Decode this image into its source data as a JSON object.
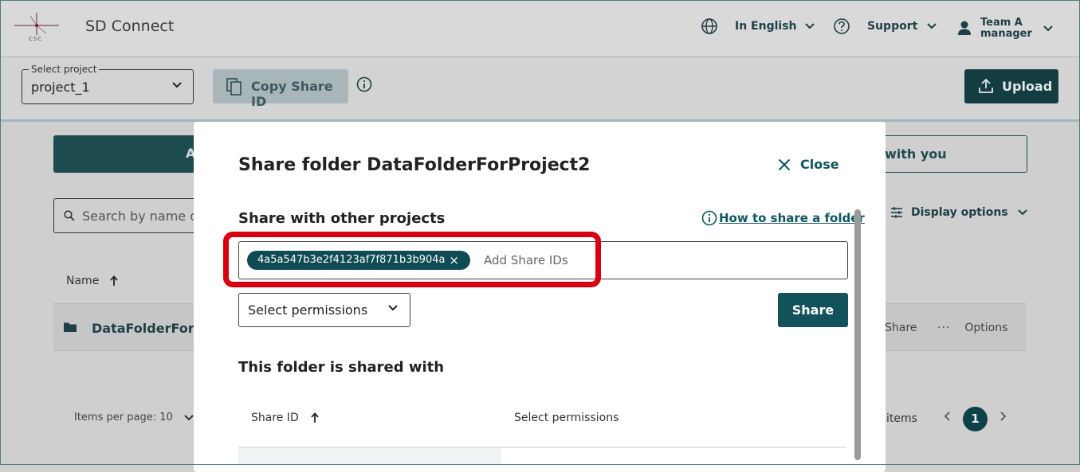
{
  "header": {
    "app_title": "SD Connect",
    "logo_text": "CSC",
    "language": "In English",
    "support": "Support",
    "user_line1": "Team A",
    "user_line2": "manager"
  },
  "toolbar": {
    "select_project_label": "Select project",
    "select_project_value": "project_1",
    "copy_share_id": "Copy Share ID",
    "upload": "Upload"
  },
  "background": {
    "tab_left_partial": "A",
    "tab_right_partial": "with you",
    "search_placeholder": "Search by name or",
    "display_options": "Display options",
    "name_column": "Name",
    "row_name": "DataFolderForPré",
    "row_share": "Share",
    "row_options": "Options",
    "items_per_page": "Items per page: 10",
    "items_right": "items",
    "current_page": "1"
  },
  "modal": {
    "title": "Share folder DataFolderForProject2",
    "close": "Close",
    "share_heading": "Share with other projects",
    "how_to_link": "How to share a folder",
    "chip_value": "4a5a547b3e2f4123af7f871b3b904a",
    "chip_remove": "×",
    "add_placeholder": "Add Share IDs",
    "permissions_value": "Select permissions",
    "share_button": "Share",
    "shared_with_heading": "This folder is shared with",
    "table_headers": [
      "Share ID",
      "Select permissions"
    ]
  },
  "colors": {
    "primary": "#12525b",
    "highlight": "#d90010",
    "overlay": "#cfcfcf"
  }
}
